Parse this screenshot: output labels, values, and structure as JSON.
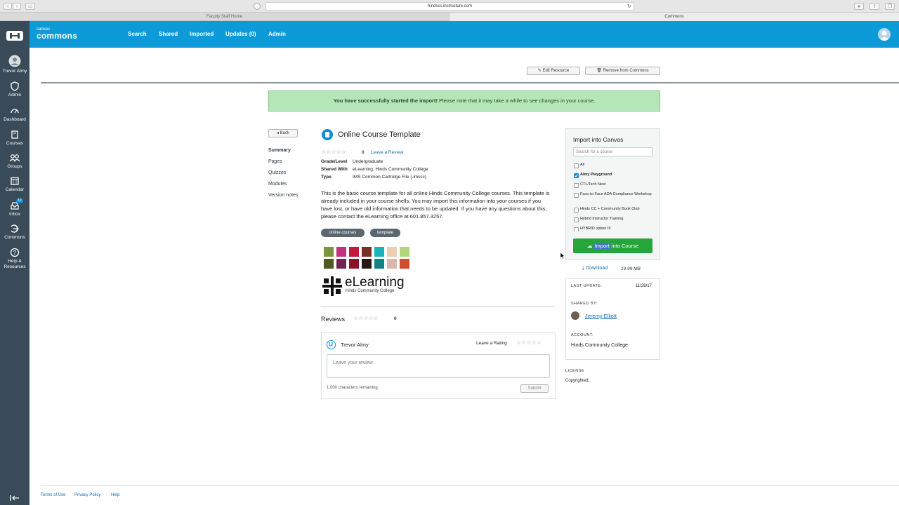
{
  "browser": {
    "url": "hindscc.instructure.com",
    "tabs": [
      "Faculty Staff Home",
      "Commons"
    ]
  },
  "sidebar": {
    "items": [
      {
        "label": "Trevor Almy",
        "icon": "user-avatar-icon"
      },
      {
        "label": "Admin",
        "icon": "shield-icon"
      },
      {
        "label": "Dashboard",
        "icon": "dashboard-icon"
      },
      {
        "label": "Courses",
        "icon": "book-icon"
      },
      {
        "label": "Groups",
        "icon": "groups-icon"
      },
      {
        "label": "Calendar",
        "icon": "calendar-icon"
      },
      {
        "label": "Inbox",
        "icon": "inbox-icon",
        "badge": "10"
      },
      {
        "label": "Commons",
        "icon": "commons-icon"
      },
      {
        "label": "Help &",
        "label2": "Resources",
        "icon": "help-icon"
      }
    ]
  },
  "topnav": {
    "brand_small": "canvas",
    "brand_big": "commons",
    "links": [
      "Search",
      "Shared",
      "Imported",
      "Updates (0)",
      "Admin"
    ]
  },
  "actions": {
    "edit": "Edit Resource",
    "remove": "Remove from Commons"
  },
  "alert": {
    "bold": "You have successfully started the import!",
    "rest": " Please note that it may take a while to see changes in your course."
  },
  "subnav": {
    "back": "◂ Back",
    "items": [
      "Summary",
      "Pages",
      "Quizzes",
      "Modules",
      "Version notes"
    ]
  },
  "resource": {
    "title": "Online Course Template",
    "rating_count": "0",
    "leave_review": "Leave a Review",
    "meta": [
      {
        "label": "Grade/Level",
        "value": "Undergraduate"
      },
      {
        "label": "Shared With",
        "value": "eLearning, Hinds Community College"
      },
      {
        "label": "Type",
        "value": "IMS Common Cartridge File (.imscc)"
      }
    ],
    "description": "This is the basic course template for all online Hinds Community College courses. This template is already included in your course shells. You may import this information into your courses if you have lost, or have old information that needs to be updated. If you have any questions about this, please contact the eLearning office at 601.857.3257.",
    "tags": [
      "online courses",
      "template"
    ],
    "swatches": [
      "#7c9440",
      "#c42f7f",
      "#c21839",
      "#7a2c25",
      "#1ab3bd",
      "#efcdb3",
      "#b4d67a",
      "#4d5a24",
      "#6e2651",
      "#8a1328",
      "#231816",
      "#0d8584",
      "#d7b8ad",
      "#d44a2e"
    ],
    "logo_text": "eLearning",
    "logo_sub": "Hinds Community College"
  },
  "reviews": {
    "heading": "Reviews",
    "count": "0",
    "reviewer": "Trevor Almy",
    "leave_rating": "Leave a Rating",
    "placeholder": "Leave your review",
    "chars": "1,000 characters remaining",
    "submit": "Submit"
  },
  "import_panel": {
    "title": "Import into Canvas",
    "search_placeholder": "Search for a course",
    "courses": [
      {
        "label": "All",
        "checked": false
      },
      {
        "label": "Almy Playground",
        "checked": true
      },
      {
        "label": "CTL/Tech Nest",
        "checked": false
      },
      {
        "label": "Face-to-Face ADA Compliance Workshop",
        "checked": false
      },
      {
        "label": "Hinds CC + Community Book Club",
        "checked": false
      },
      {
        "label": "Hybrid Instructor Training",
        "checked": false
      },
      {
        "label": "HYBRID option III",
        "checked": false
      }
    ],
    "button_hl": "Import",
    "button_rest": " into Course",
    "download": "Download",
    "size": "19.99 MB"
  },
  "info": {
    "last_update_label": "LAST UPDATE:",
    "last_update": "11/28/17",
    "shared_by_label": "SHARED BY:",
    "shared_by": "Jeremy Elliott",
    "account_label": "ACCOUNT:",
    "account": "Hinds Community College",
    "license_label": "LICENSE",
    "license": "Copyrighted."
  },
  "footer": {
    "links": [
      "Terms of Use",
      "Privacy Policy",
      "Help"
    ]
  },
  "colors": {
    "brand": "#0d9ad9",
    "sidebar": "#394b58",
    "success_bg": "#b5e6b8",
    "import_button": "#26a63a"
  }
}
